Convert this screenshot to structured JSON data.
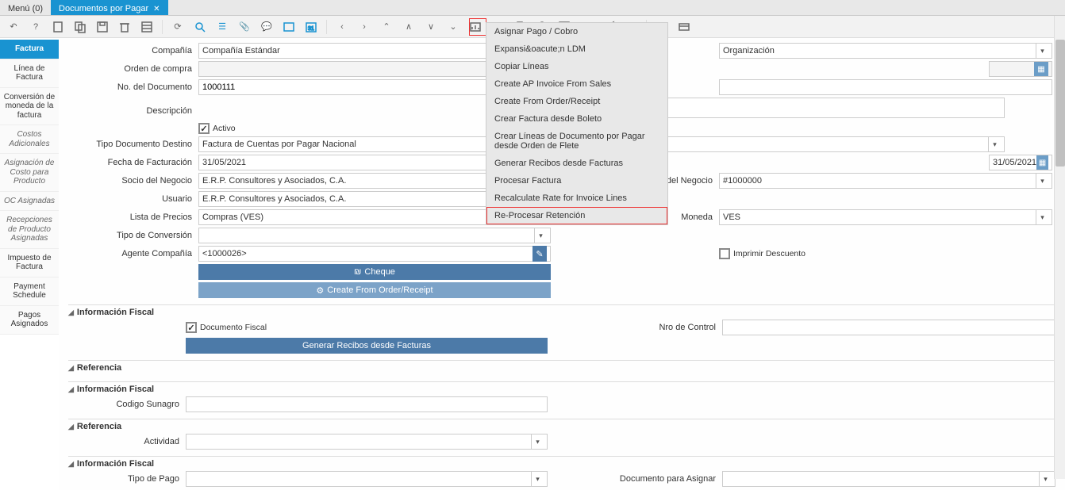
{
  "tabs": {
    "menu": "Menú (0)",
    "active": "Documentos por Pagar"
  },
  "side": {
    "items": [
      {
        "label": "Factura",
        "state": "active"
      },
      {
        "label": "Línea de Factura",
        "state": "enabled"
      },
      {
        "label": "Conversión de moneda de la factura",
        "state": "enabled"
      },
      {
        "label": "Costos Adicionales",
        "state": "disabled"
      },
      {
        "label": "Asignación de Costo para Producto",
        "state": "disabled"
      },
      {
        "label": "OC Asignadas",
        "state": "disabled"
      },
      {
        "label": "Recepciones de Producto Asignadas",
        "state": "disabled"
      },
      {
        "label": "Impuesto de Factura",
        "state": "enabled"
      },
      {
        "label": "Payment Schedule",
        "state": "enabled"
      },
      {
        "label": "Pagos Asignados",
        "state": "enabled"
      }
    ]
  },
  "menu": {
    "items": [
      "Asignar Pago / Cobro",
      "Expansi&oacute;n LDM",
      "Copiar Líneas",
      "Create AP Invoice From Sales",
      "Create From Order/Receipt",
      "Crear Factura desde Boleto",
      "Crear Líneas de Documento por Pagar desde Orden de Flete",
      "Generar Recibos desde Facturas",
      "Procesar Factura",
      "Recalculate Rate for Invoice Lines",
      "Re-Procesar Retención"
    ]
  },
  "form": {
    "compania_lbl": "Compañía",
    "compania_val": "Compañía Estándar",
    "org_val": "Organización",
    "orden_lbl": "Orden de compra",
    "nodoc_lbl": "No. del Documento",
    "nodoc_val": "1000111",
    "desc_lbl": "Descripción",
    "activo_lbl": "Activo",
    "tipodoc_lbl": "Tipo Documento Destino",
    "tipodoc_val": "Factura de Cuentas por Pagar Nacional",
    "fecha_lbl": "Fecha de Facturación",
    "fecha_val": "31/05/2021",
    "fecha2_val": "31/05/2021",
    "socio_lbl": "Socio del Negocio",
    "socio_val": "E.R.P. Consultores y Asociados, C.A.",
    "dir_lbl": "Dirección del Socio del Negocio",
    "dir_val": "#1000000",
    "usuario_lbl": "Usuario",
    "usuario_val": "E.R.P. Consultores y Asociados, C.A.",
    "lista_lbl": "Lista de Precios",
    "lista_val": "Compras (VES)",
    "moneda_lbl": "Moneda",
    "moneda_val": "VES",
    "tipoconv_lbl": "Tipo de Conversión",
    "agente_lbl": "Agente Compañía",
    "agente_val": "<1000026>",
    "imprimir_lbl": "Imprimir Descuento",
    "btn_cheque": "Cheque",
    "btn_create": "Create From Order/Receipt",
    "sec_info": "Información Fiscal",
    "docfiscal_lbl": "Documento Fiscal",
    "nro_lbl": "Nro de Control",
    "btn_generar": "Generar Recibos desde Facturas",
    "sec_ref": "Referencia",
    "codsun_lbl": "Codigo Sunagro",
    "actividad_lbl": "Actividad",
    "tipopago_lbl": "Tipo de Pago",
    "docasig_lbl": "Documento para Asignar"
  }
}
